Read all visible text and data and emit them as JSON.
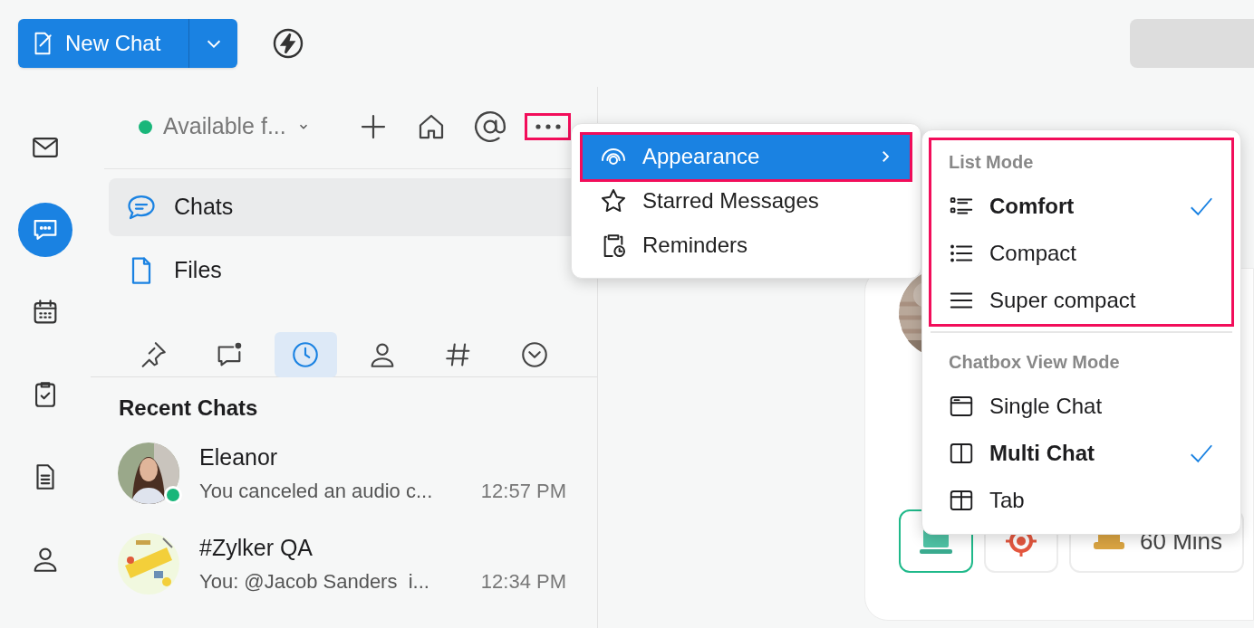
{
  "toolbar": {
    "new_chat": "New Chat"
  },
  "rail": [
    {
      "kind": "mail",
      "selected": false
    },
    {
      "kind": "chat",
      "selected": true
    },
    {
      "kind": "calendar",
      "selected": false
    },
    {
      "kind": "tasks",
      "selected": false
    },
    {
      "kind": "notes",
      "selected": false
    },
    {
      "kind": "contacts",
      "selected": false
    }
  ],
  "status": "Available f...",
  "more_button": {
    "highlighted": true
  },
  "nav": [
    {
      "kind": "chats",
      "label": "Chats",
      "selected": true
    },
    {
      "kind": "files",
      "label": "Files",
      "selected": false
    }
  ],
  "filter_tabs": [
    {
      "kind": "pin",
      "selected": false
    },
    {
      "kind": "unread",
      "selected": false
    },
    {
      "kind": "recent",
      "selected": true
    },
    {
      "kind": "contacts",
      "selected": false
    },
    {
      "kind": "channels",
      "selected": false
    },
    {
      "kind": "more",
      "selected": false
    }
  ],
  "recent": {
    "title": "Recent Chats",
    "chats": [
      {
        "name": "Eleanor",
        "preview": "You canceled an audio c...",
        "time": "12:57 PM",
        "online": true
      },
      {
        "name": "#Zylker QA",
        "preview": "You: @Jacob Sanders  i...",
        "time": "12:34 PM",
        "online": false
      }
    ]
  },
  "card": {
    "tiles": [
      {
        "kind": "laptop",
        "selected": true
      },
      {
        "kind": "target",
        "selected": false
      },
      {
        "kind": "timer",
        "label": "60 Mins",
        "selected": false
      }
    ]
  },
  "menu": {
    "items": [
      {
        "kind": "appearance",
        "label": "Appearance",
        "selected": true,
        "highlighted": true
      },
      {
        "kind": "star",
        "label": "Starred Messages",
        "selected": false,
        "highlighted": false
      },
      {
        "kind": "reminder",
        "label": "Reminders",
        "selected": false,
        "highlighted": false
      }
    ]
  },
  "submenu": {
    "sections": [
      {
        "title": "List Mode",
        "highlighted": true,
        "items": [
          {
            "kind": "comfort",
            "label": "Comfort",
            "checked": true
          },
          {
            "kind": "compact",
            "label": "Compact",
            "checked": false
          },
          {
            "kind": "supercompact",
            "label": "Super compact",
            "checked": false
          }
        ]
      },
      {
        "title": "Chatbox View Mode",
        "highlighted": false,
        "items": [
          {
            "kind": "single",
            "label": "Single Chat",
            "checked": false
          },
          {
            "kind": "multi",
            "label": "Multi Chat",
            "checked": true
          },
          {
            "kind": "tab",
            "label": "Tab",
            "checked": false
          }
        ]
      }
    ]
  }
}
